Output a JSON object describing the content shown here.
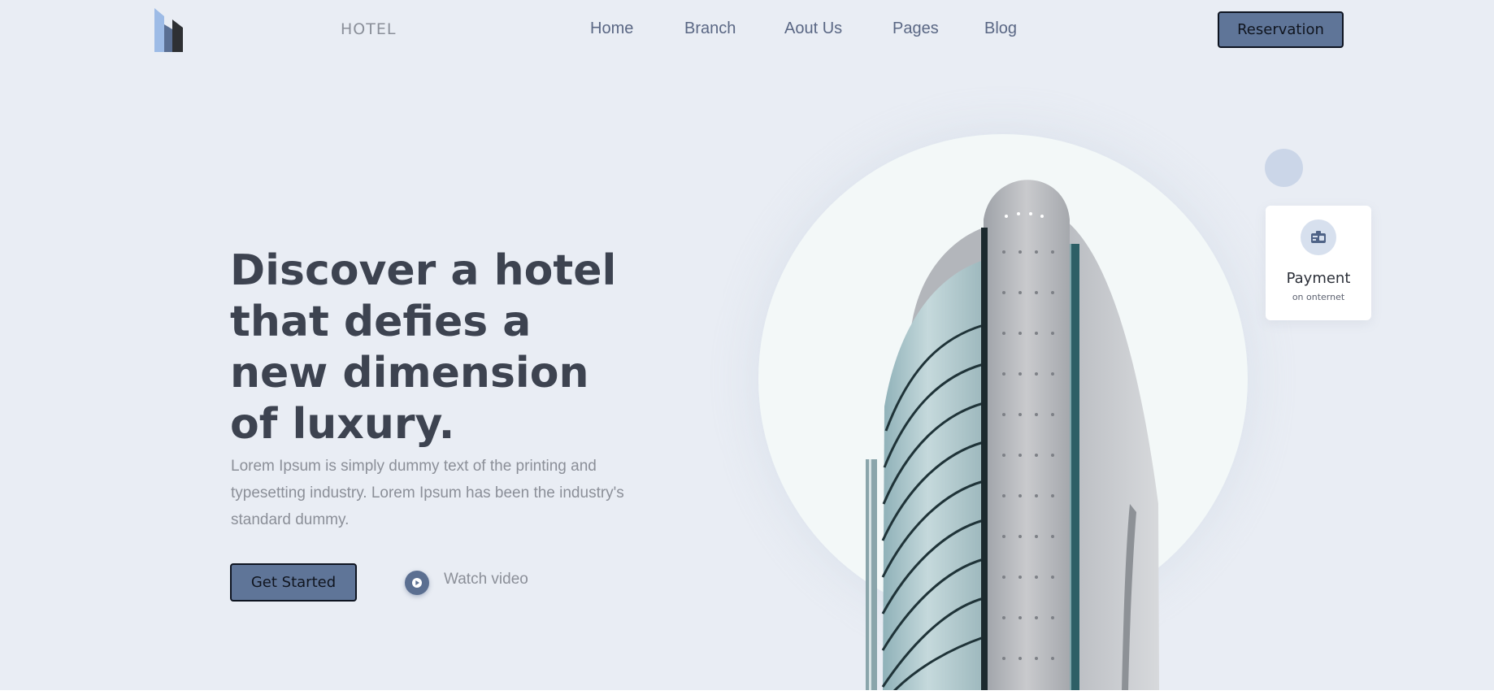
{
  "header": {
    "brand": "HOTEL",
    "nav": [
      {
        "label": "Home"
      },
      {
        "label": "Branch"
      },
      {
        "label": "Aout Us"
      },
      {
        "label": "Pages"
      },
      {
        "label": "Blog"
      }
    ],
    "reservation_label": "Reservation"
  },
  "hero": {
    "headline": "Discover a hotel that defies a new dimension of luxury.",
    "description": "Lorem Ipsum is simply dummy text of the printing and typesetting industry. Lorem Ipsum has been the industry's standard dummy.",
    "get_started_label": "Get Started",
    "watch_video_label": "Watch video"
  },
  "payment_card": {
    "title": "Payment",
    "subtitle": "on onternet",
    "icon": "id-card-icon"
  },
  "colors": {
    "background": "#e9edf4",
    "accent": "#5f7598",
    "headline": "#3d4350",
    "muted_text": "#8b8f98"
  }
}
